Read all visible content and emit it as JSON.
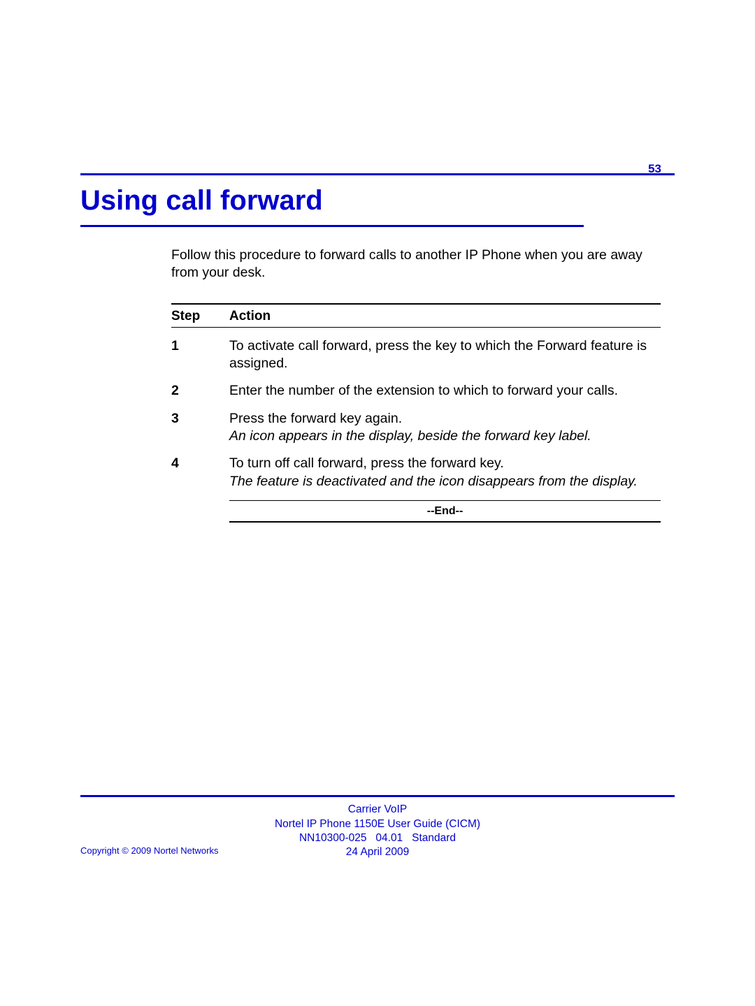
{
  "page_number": "53",
  "title": "Using call forward",
  "intro": "Follow this procedure to forward calls to another IP Phone when you are away from your desk.",
  "table": {
    "header_step": "Step",
    "header_action": "Action",
    "rows": [
      {
        "step": "1",
        "action": "To activate call forward, press the key to which the Forward feature is assigned.",
        "note": ""
      },
      {
        "step": "2",
        "action": "Enter the number of the extension to which to forward your calls.",
        "note": ""
      },
      {
        "step": "3",
        "action": "Press the forward key again.",
        "note": "An icon appears in the display, beside the forward key label."
      },
      {
        "step": "4",
        "action": "To turn off call forward, press the forward key.",
        "note": "The feature is deactivated and the icon disappears from the display."
      }
    ],
    "end_marker": "--End--"
  },
  "footer": {
    "line1": "Carrier VoIP",
    "line2": "Nortel IP Phone 1150E User Guide (CICM)",
    "line3a": "NN10300-025",
    "line3b": "04.01",
    "line3c": "Standard",
    "line4": "24 April 2009"
  },
  "copyright": "Copyright © 2009 Nortel Networks"
}
